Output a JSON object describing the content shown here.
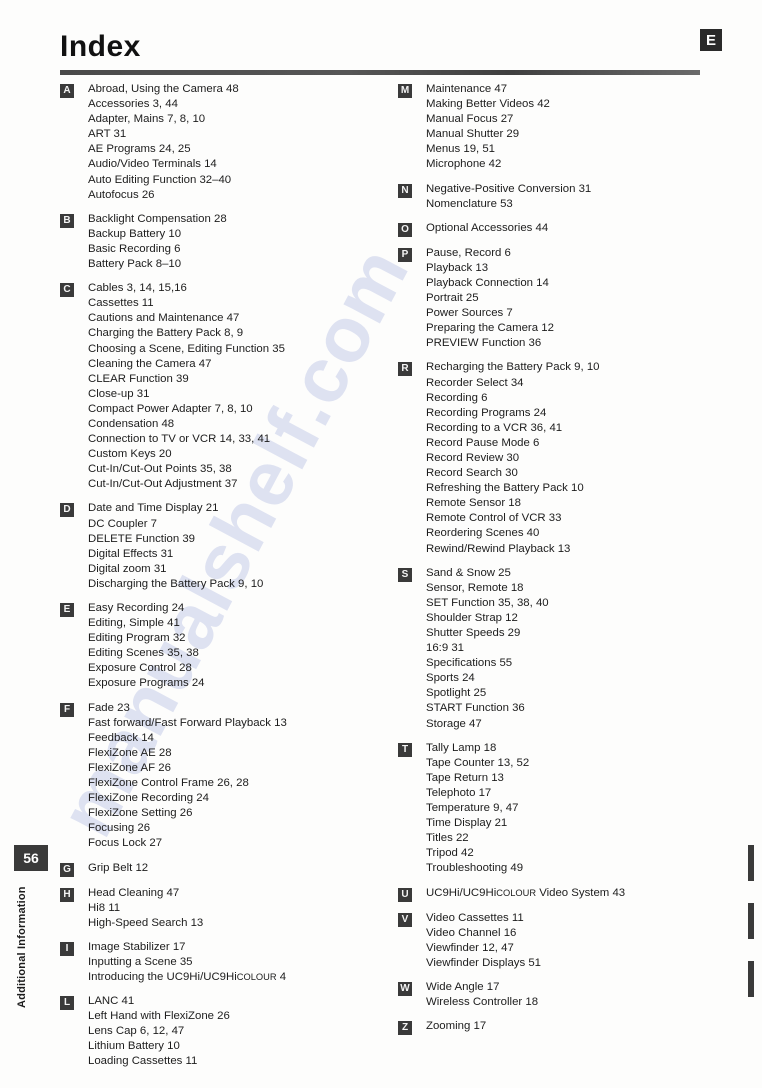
{
  "header": {
    "title": "Index",
    "corner_badge": "E"
  },
  "footer": {
    "page_number": "56",
    "section_label": "Additional Information"
  },
  "watermark": {
    "text": "manualshelf.com"
  },
  "columns": [
    {
      "groups": [
        {
          "letter": "A",
          "entries": [
            "Abroad, Using the Camera  48",
            "Accessories  3, 44",
            "Adapter, Mains  7, 8, 10",
            "ART  31",
            "AE Programs  24, 25",
            "Audio/Video Terminals  14",
            "Auto Editing Function  32–40",
            "Autofocus  26"
          ]
        },
        {
          "letter": "B",
          "entries": [
            "Backlight Compensation  28",
            "Backup Battery  10",
            "Basic Recording  6",
            "Battery Pack  8–10"
          ]
        },
        {
          "letter": "C",
          "entries": [
            "Cables  3, 14, 15,16",
            "Cassettes  11",
            "Cautions and Maintenance  47",
            "Charging the Battery Pack  8, 9",
            "Choosing a Scene, Editing Function  35",
            "Cleaning the Camera  47",
            "CLEAR Function  39",
            "Close-up  31",
            "Compact Power Adapter  7, 8, 10",
            "Condensation  48",
            "Connection to TV or VCR  14, 33, 41",
            "Custom Keys  20",
            "Cut-In/Cut-Out Points  35, 38",
            "Cut-In/Cut-Out Adjustment  37"
          ]
        },
        {
          "letter": "D",
          "entries": [
            "Date and Time Display  21",
            "DC Coupler  7",
            "DELETE Function  39",
            "Digital Effects  31",
            "Digital zoom  31",
            "Discharging the Battery Pack  9, 10"
          ]
        },
        {
          "letter": "E",
          "entries": [
            "Easy Recording  24",
            "Editing, Simple  41",
            "Editing Program  32",
            "Editing Scenes  35, 38",
            "Exposure Control  28",
            "Exposure Programs  24"
          ]
        },
        {
          "letter": "F",
          "entries": [
            "Fade  23",
            "Fast forward/Fast Forward Playback  13",
            "Feedback  14",
            "FlexiZone AE  28",
            "FlexiZone AF  26",
            "FlexiZone Control Frame  26, 28",
            "FlexiZone Recording  24",
            "FlexiZone Setting  26",
            "Focusing  26",
            "Focus Lock  27"
          ]
        },
        {
          "letter": "G",
          "entries": [
            "Grip Belt  12"
          ]
        },
        {
          "letter": "H",
          "entries": [
            "Head Cleaning  47",
            "Hi8  11",
            "High-Speed Search  13"
          ]
        },
        {
          "letter": "I",
          "entries": [
            "Image Stabilizer  17",
            "Inputting a Scene  35",
            "Introducing the UC9Hi/UC9HicoLOUR  4"
          ]
        },
        {
          "letter": "L",
          "entries": [
            "LANC  41",
            "Left Hand with FlexiZone  26",
            "Lens Cap  6, 12, 47",
            "Lithium Battery  10",
            "Loading Cassettes  11"
          ]
        }
      ]
    },
    {
      "groups": [
        {
          "letter": "M",
          "entries": [
            "Maintenance  47",
            "Making Better Videos  42",
            "Manual Focus  27",
            "Manual Shutter  29",
            "Menus  19, 51",
            "Microphone  42"
          ]
        },
        {
          "letter": "N",
          "entries": [
            "Negative-Positive Conversion  31",
            "Nomenclature  53"
          ]
        },
        {
          "letter": "O",
          "entries": [
            "Optional Accessories  44"
          ]
        },
        {
          "letter": "P",
          "entries": [
            "Pause, Record  6",
            "Playback  13",
            "Playback Connection  14",
            "Portrait  25",
            "Power Sources  7",
            "Preparing the Camera  12",
            "PREVIEW Function  36"
          ]
        },
        {
          "letter": "R",
          "entries": [
            "Recharging the Battery Pack  9, 10",
            "Recorder Select  34",
            "Recording  6",
            "Recording Programs  24",
            "Recording to a VCR  36, 41",
            "Record Pause Mode  6",
            "Record Review  30",
            "Record Search  30",
            "Refreshing the Battery Pack  10",
            "Remote Sensor  18",
            "Remote Control of VCR  33",
            "Reordering Scenes  40",
            "Rewind/Rewind Playback  13"
          ]
        },
        {
          "letter": "S",
          "entries": [
            "Sand & Snow  25",
            "Sensor, Remote  18",
            "SET Function  35, 38, 40",
            "Shoulder Strap  12",
            "Shutter Speeds  29",
            "16:9  31",
            "Specifications  55",
            "Sports  24",
            "Spotlight  25",
            "START Function  36",
            "Storage  47"
          ]
        },
        {
          "letter": "T",
          "entries": [
            "Tally Lamp  18",
            "Tape Counter  13, 52",
            "Tape Return  13",
            "Telephoto  17",
            "Temperature  9, 47",
            "Time Display  21",
            "Titles  22",
            "Tripod  42",
            "Troubleshooting  49"
          ]
        },
        {
          "letter": "U",
          "entries": [
            "UC9Hi/UC9HicoLOUR Video System  43"
          ]
        },
        {
          "letter": "V",
          "entries": [
            "Video Cassettes  11",
            "Video Channel  16",
            "Viewfinder  12, 47",
            "Viewfinder Displays  51"
          ]
        },
        {
          "letter": "W",
          "entries": [
            "Wide Angle  17",
            "Wireless Controller  18"
          ]
        },
        {
          "letter": "Z",
          "entries": [
            "Zooming  17"
          ]
        }
      ]
    }
  ]
}
